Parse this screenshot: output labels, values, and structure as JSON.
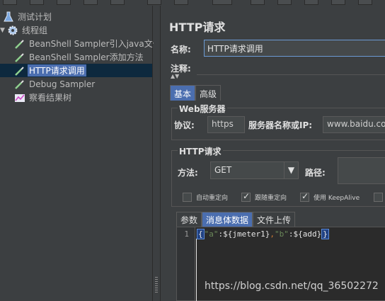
{
  "tree": {
    "items": [
      {
        "label": "测试计划",
        "icon": "flask-icon"
      },
      {
        "label": "线程组",
        "icon": "gear-icon"
      },
      {
        "label": "BeanShell Sampler引入java文件",
        "icon": "pipette-icon"
      },
      {
        "label": "BeanShell Sampler添加方法",
        "icon": "pipette-icon"
      },
      {
        "label": "HTTP请求调用",
        "icon": "pipette-icon",
        "selected": true
      },
      {
        "label": "Debug Sampler",
        "icon": "pipette-icon"
      },
      {
        "label": "察看结果树",
        "icon": "chart-icon"
      }
    ]
  },
  "panel": {
    "title": "HTTP请求",
    "name_label": "名称:",
    "name_value": "HTTP请求调用",
    "comment_label": "注释:",
    "tabs": [
      "基本",
      "高级"
    ],
    "web_server": {
      "group_title": "Web服务器",
      "protocol_label": "协议:",
      "protocol_value": "https",
      "server_label": "服务器名称或IP:",
      "server_value": "www.baidu.com"
    },
    "http_request": {
      "group_title": "HTTP请求",
      "method_label": "方法:",
      "method_value": "GET",
      "path_label": "路径:"
    },
    "checkboxes": [
      {
        "label": "自动重定向",
        "checked": false
      },
      {
        "label": "跟随重定向",
        "checked": true
      },
      {
        "label": "使用 KeepAlive",
        "checked": true
      }
    ],
    "body_tabs": [
      "参数",
      "消息体数据",
      "文件上传"
    ],
    "editor": {
      "line_number": "1",
      "code_open": "{",
      "code_key1": "\"a\"",
      "code_sep1": ":",
      "code_val1": "${jmeter1}",
      "code_comma": ",",
      "code_key2": "\"b\"",
      "code_sep2": ":",
      "code_val2": "${add}",
      "code_close": "}"
    }
  },
  "watermark": "https://blog.csdn.net/qq_36502272"
}
